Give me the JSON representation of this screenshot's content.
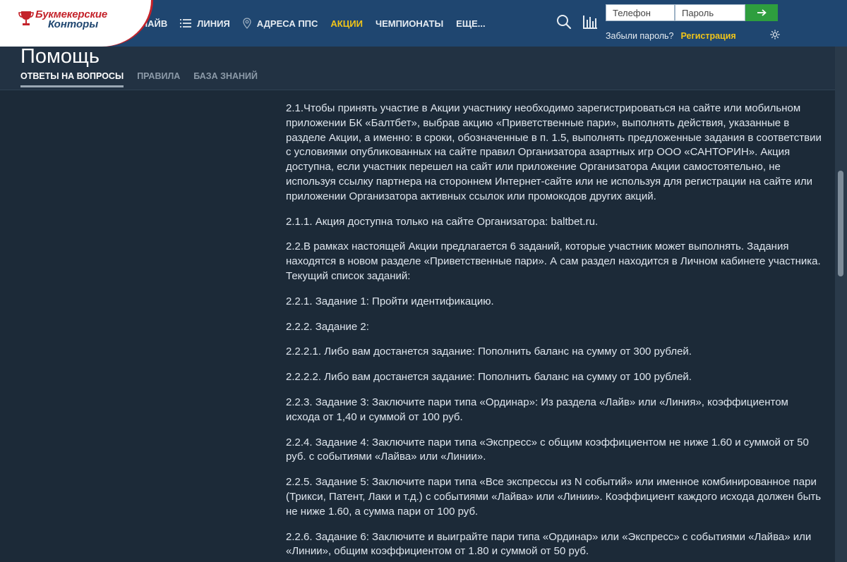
{
  "logo": {
    "line1": "Букмекерские",
    "line2": "Конторы"
  },
  "nav": {
    "items": [
      {
        "label": "ЛАЙВ",
        "icon": "none"
      },
      {
        "label": "ЛИНИЯ",
        "icon": "list-icon"
      },
      {
        "label": "АДРЕСА ППС",
        "icon": "location-pin-icon"
      },
      {
        "label": "АКЦИИ",
        "icon": "none"
      },
      {
        "label": "ЧЕМПИОНАТЫ",
        "icon": "none"
      },
      {
        "label": "ЕЩЕ...",
        "icon": "none"
      }
    ]
  },
  "auth": {
    "phone_placeholder": "Телефон",
    "password_placeholder": "Пароль",
    "forgot": "Забыли пароль?",
    "register": "Регистрация"
  },
  "help": {
    "title": "Помощь",
    "tabs": [
      "ОТВЕТЫ НА ВОПРОСЫ",
      "ПРАВИЛА",
      "БАЗА ЗНАНИЙ"
    ]
  },
  "content": {
    "paragraphs": [
      "2.1.Чтобы принять участие в Акции участнику необходимо зарегистрироваться на сайте или мобильном приложении БК «Балтбет», выбрав акцию «Приветственные пари», выполнять действия, указанные в разделе Акции, а именно: в сроки, обозначенные в п. 1.5, выполнять предложенные задания  в соответствии с условиями опубликованных на сайте правил Организатора азартных игр ООО «САНТОРИН». Акция доступна, если участник перешел на сайт или приложение Организатора Акции самостоятельно, не используя ссылку партнера на стороннем Интернет-сайте или не используя для регистрации на сайте или приложении Организатора активных ссылок или промокодов  других акций.",
      "2.1.1. Акция доступна только на сайте Организатора: baltbet.ru.",
      "2.2.В рамках настоящей Акции предлагается 6 заданий, которые участник может выполнять. Задания находятся в новом разделе «Приветственные пари». А сам раздел находится в Личном кабинете участника. Текущий список заданий:",
      "2.2.1. Задание 1: Пройти идентификацию.",
      "2.2.2. Задание 2:",
      "2.2.2.1. Либо вам достанется задание: Пополнить баланс на сумму от 300 рублей.",
      "2.2.2.2. Либо вам достанется задание: Пополнить баланс на сумму от 100 рублей.",
      "2.2.3. Задание 3: Заключите пари типа «Ординар»: Из раздела «Лайв» или «Линия», коэффициентом исхода от 1,40 и суммой от 100 руб.",
      "2.2.4. Задание 4: Заключите пари типа «Экспресс» с общим коэффициентом не ниже 1.60 и суммой от 50 руб. с событиями «Лайва» или «Линии».",
      "2.2.5. Задание 5: Заключите пари типа «Все экспрессы из N событий» или именное комбинированное пари (Трикси, Патент, Лаки и т.д.) с событиями «Лайва» или «Линии». Коэффициент каждого исхода должен быть не ниже 1.60, а сумма пари от 100 руб.",
      "2.2.6. Задание 6: Заключите и выиграйте пари типа «Ординар» или «Экспресс» с событиями «Лайва» или «Линии», общим коэффициентом от 1.80 и суммой от 50 руб."
    ]
  },
  "colors": {
    "nav_bg": "#1f4670",
    "accent": "#f0c419",
    "login_button": "#2e9e3e",
    "brand_red": "#c4222a"
  }
}
